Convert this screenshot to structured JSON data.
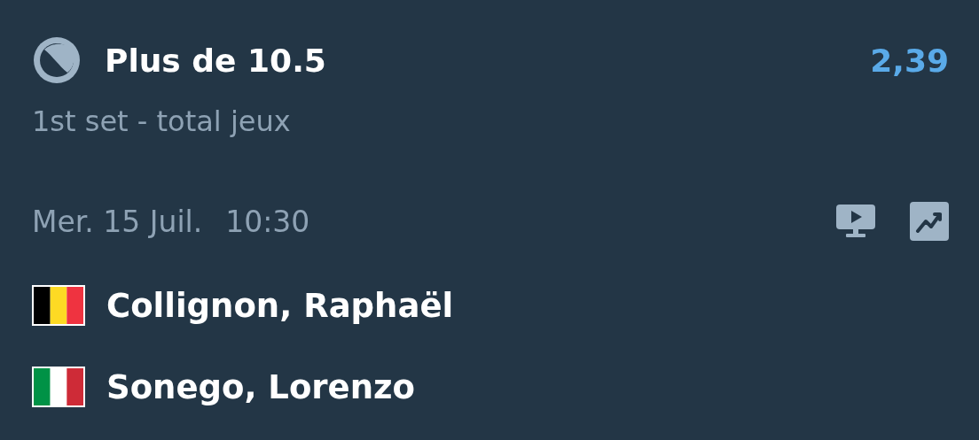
{
  "bet": {
    "selection": "Plus de 10.5",
    "odds": "2,39",
    "market": "1st set - total jeux"
  },
  "match": {
    "date": "Mer. 15 Juil.",
    "time": "10:30"
  },
  "players": [
    {
      "name": "Collignon, Raphaël",
      "kind": "belgium"
    },
    {
      "name": "Sonego, Lorenzo",
      "kind": "italy"
    }
  ]
}
